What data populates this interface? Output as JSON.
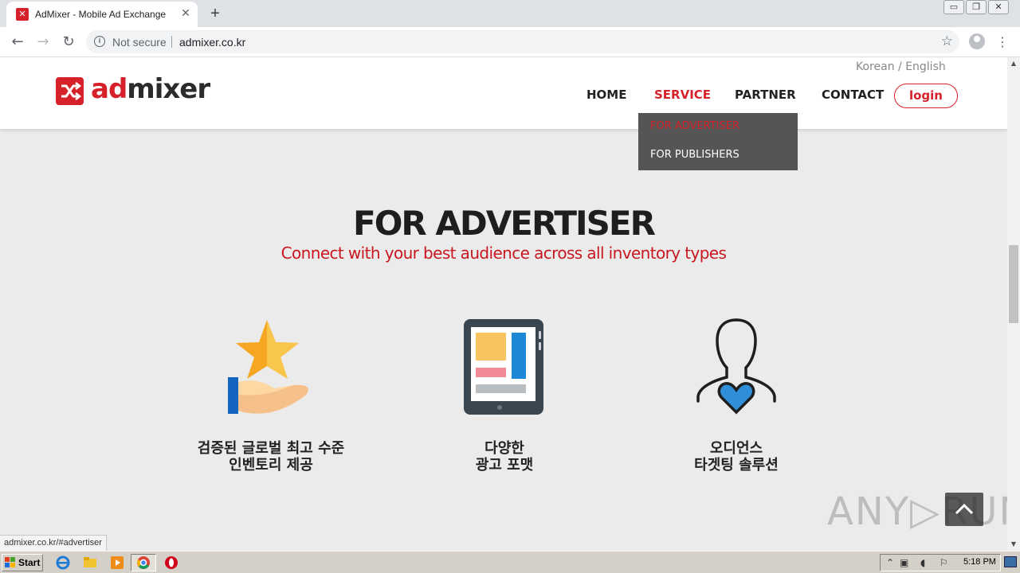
{
  "browser": {
    "tab_title": "AdMixer - Mobile Ad Exchange",
    "tab_close": "✕",
    "new_tab": "+",
    "security_label": "Not secure",
    "url": "admixer.co.kr",
    "status_url": "admixer.co.kr/#advertiser",
    "window_controls": [
      "▭",
      "❐",
      "✕"
    ]
  },
  "site": {
    "logo": {
      "ad": "ad",
      "mixer": "mixer"
    },
    "lang": {
      "korean": "Korean",
      "sep": " / ",
      "english": "English"
    },
    "nav": {
      "home": "HOME",
      "service": "SERVICE",
      "partner": "PARTNER",
      "contact": "CONTACT",
      "login": "login"
    },
    "dropdown": {
      "advertiser": "FOR ADVERTISER",
      "publishers": "FOR PUBLISHERS"
    },
    "section": {
      "title": "FOR ADVERTISER",
      "subtitle": "Connect with your best audience across all inventory types"
    },
    "features": [
      {
        "line1": "검증된 글로벌 최고 수준",
        "line2": "인벤토리 제공",
        "icon": "star-hand-icon"
      },
      {
        "line1": "다양한",
        "line2": "광고 포맷",
        "icon": "tablet-ad-icon"
      },
      {
        "line1": "오디언스",
        "line2": "타겟팅 솔루션",
        "icon": "person-heart-icon"
      }
    ],
    "watermark": "ANY▷RUN"
  },
  "taskbar": {
    "start": "Start",
    "time": "5:18 PM"
  },
  "colors": {
    "brand_red": "#d6202a",
    "dropdown_bg": "#555555",
    "page_bg": "#ebebeb"
  }
}
